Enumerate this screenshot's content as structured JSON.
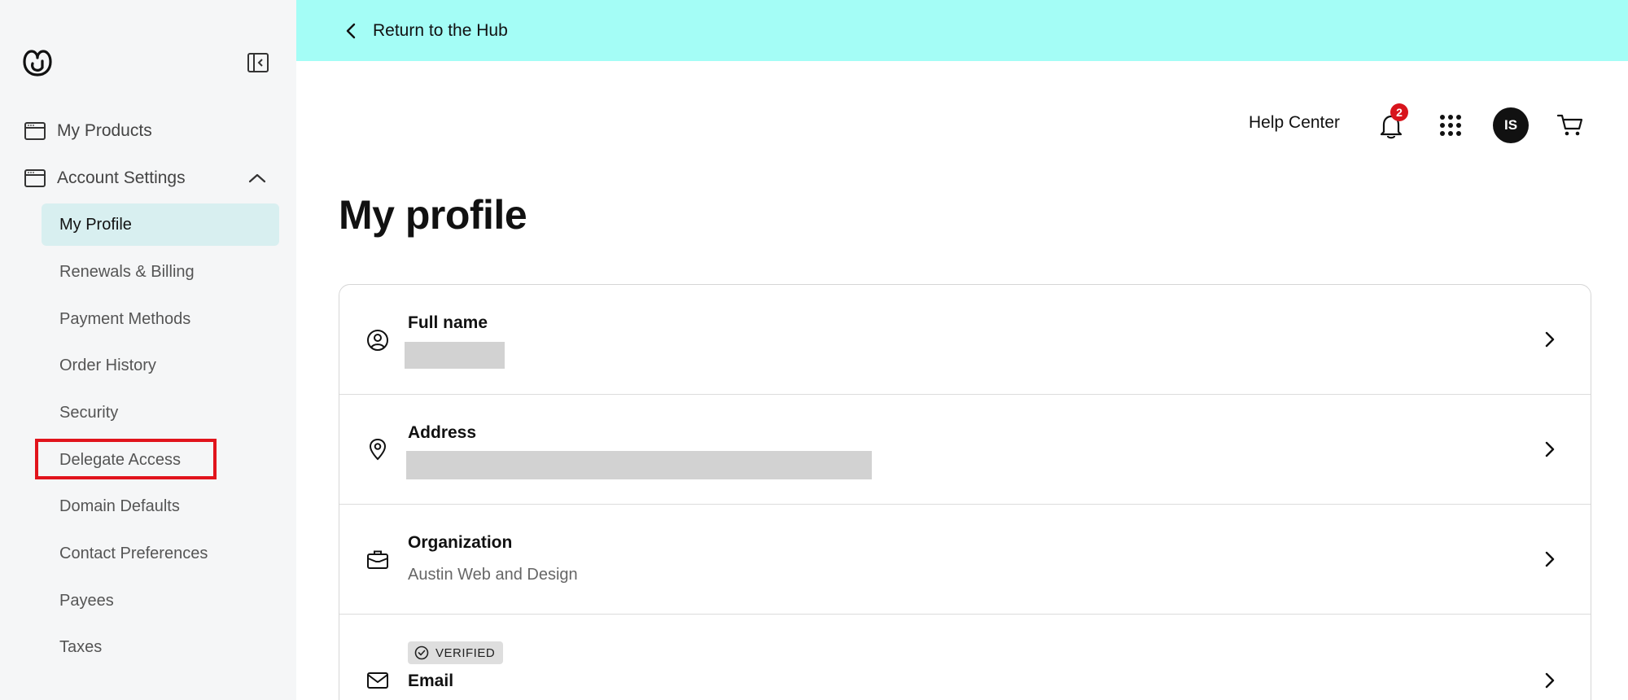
{
  "sidebar": {
    "logo_icon": "godaddy-logo-icon",
    "collapse_icon": "sidebar-collapse-icon",
    "top_items": [
      {
        "label": "My Products",
        "icon": "browser-window-icon"
      },
      {
        "label": "Account Settings",
        "icon": "browser-window-icon",
        "expanded": true
      }
    ],
    "sub_items": [
      {
        "label": "My Profile",
        "active": true
      },
      {
        "label": "Renewals & Billing"
      },
      {
        "label": "Payment Methods"
      },
      {
        "label": "Order History"
      },
      {
        "label": "Security"
      },
      {
        "label": "Delegate Access",
        "highlighted": true
      },
      {
        "label": "Domain Defaults"
      },
      {
        "label": "Contact Preferences"
      },
      {
        "label": "Payees"
      },
      {
        "label": "Taxes"
      }
    ]
  },
  "banner": {
    "back_label": "Return to the Hub",
    "color": "#a4fdf6"
  },
  "header": {
    "help_center": "Help Center",
    "notification_count": "2",
    "avatar_initials": "IS"
  },
  "page": {
    "title": "My profile"
  },
  "profile_rows": [
    {
      "title": "Full name",
      "icon": "user-circle-icon",
      "value": ""
    },
    {
      "title": "Address",
      "icon": "map-pin-icon",
      "value": ""
    },
    {
      "title": "Organization",
      "icon": "briefcase-icon",
      "value": "Austin Web and Design"
    },
    {
      "title": "Email",
      "icon": "envelope-icon",
      "badge": "VERIFIED",
      "value": ""
    }
  ],
  "colors": {
    "accent_highlight": "#e1141c",
    "active_item_bg": "#d8eff0",
    "badge_red": "#d8141c"
  }
}
